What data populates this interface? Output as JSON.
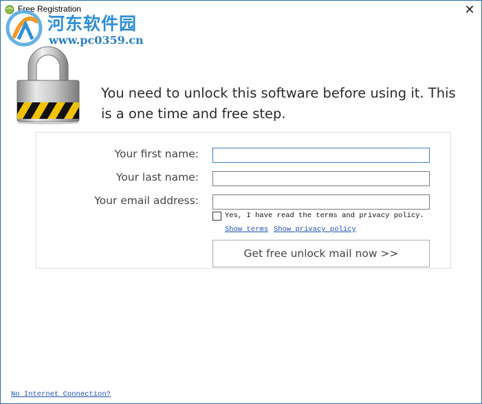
{
  "window": {
    "title": "Free Registration",
    "close_glyph": "✕"
  },
  "watermark": {
    "site_name": "河东软件园",
    "url": "www.pc0359.cn"
  },
  "headline": "You need to unlock this software before using it. This is a one time and free step.",
  "form": {
    "first_name_label": "Your first name:",
    "first_name_value": "",
    "last_name_label": "Your last name:",
    "last_name_value": "",
    "email_label": "Your email address:",
    "email_value": "",
    "agree_checked": false,
    "agree_text": "Yes, I have read the terms and privacy policy.",
    "show_terms": "Show terms",
    "show_privacy": "Show privacy policy",
    "submit_label": "Get free unlock mail now >>"
  },
  "footer": {
    "connection_link": "No Internet Connection?"
  },
  "icons": {
    "app": "app-globe-icon",
    "lock": "padlock-icon",
    "close": "close-icon",
    "watermark_logo": "watermark-logo-icon"
  },
  "colors": {
    "window_border": "#2b6cb0",
    "link": "#1a4fb5",
    "focus_border": "#3a7cc0",
    "watermark_blue": "#2f8fd6"
  }
}
